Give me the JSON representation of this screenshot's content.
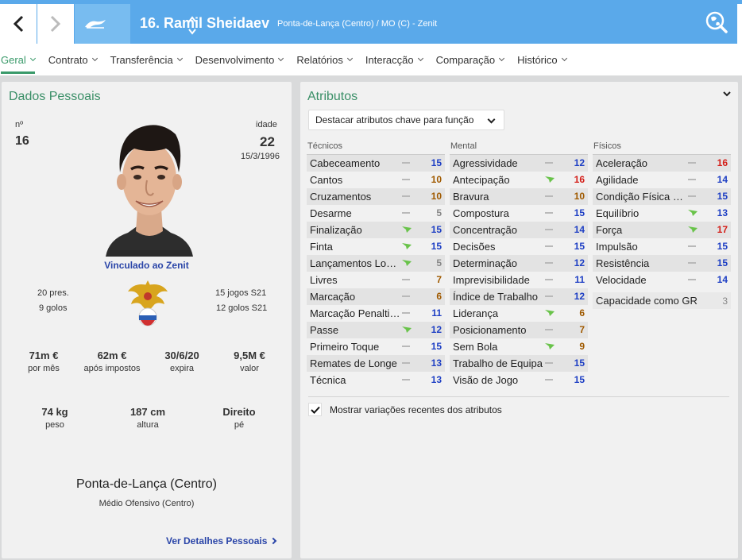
{
  "header": {
    "title": "16. Ramil Sheidaev",
    "subtitle": "Ponta-de-Lança (Centro) / MO (C) - Zenit"
  },
  "tabs": [
    {
      "label": "Geral",
      "active": true
    },
    {
      "label": "Contrato"
    },
    {
      "label": "Transferência"
    },
    {
      "label": "Desenvolvimento"
    },
    {
      "label": "Relatórios"
    },
    {
      "label": "Interacção"
    },
    {
      "label": "Comparação"
    },
    {
      "label": "Histórico"
    }
  ],
  "personal": {
    "heading": "Dados Pessoais",
    "number_label": "nº",
    "number": "16",
    "age_label": "idade",
    "age": "22",
    "dob": "15/3/1996",
    "linked": "Vinculado ao Zenit",
    "caps": "20 pres.",
    "goals": "9 golos",
    "u21_caps": "15 jogos S21",
    "u21_goals": "12 golos S21",
    "stats1": [
      {
        "value": "71m €",
        "label": "por mês"
      },
      {
        "value": "62m €",
        "label": "após impostos"
      },
      {
        "value": "30/6/20",
        "label": "expira"
      },
      {
        "value": "9,5M €",
        "label": "valor"
      }
    ],
    "stats2": [
      {
        "value": "74 kg",
        "label": "peso"
      },
      {
        "value": "187 cm",
        "label": "altura"
      },
      {
        "value": "Direito",
        "label": "pé"
      }
    ],
    "position": "Ponta-de-Lança (Centro)",
    "role": "Médio Ofensivo (Centro)",
    "details_link": "Ver Detalhes Pessoais"
  },
  "attributes": {
    "heading": "Atributos",
    "dropdown": "Destacar atributos chave para função",
    "colors": {
      "blue": "#1e3fc4",
      "orange": "#a05a00",
      "red": "#d4201a",
      "grey": "#888888"
    },
    "columns": [
      {
        "header": "Técnicos",
        "rows": [
          {
            "name": "Cabeceamento",
            "trend": "flat",
            "value": "15",
            "color": "blue"
          },
          {
            "name": "Cantos",
            "trend": "flat",
            "value": "10",
            "color": "orange"
          },
          {
            "name": "Cruzamentos",
            "trend": "flat",
            "value": "10",
            "color": "orange"
          },
          {
            "name": "Desarme",
            "trend": "flat",
            "value": "5",
            "color": "grey"
          },
          {
            "name": "Finalização",
            "trend": "up",
            "value": "15",
            "color": "blue"
          },
          {
            "name": "Finta",
            "trend": "up",
            "value": "15",
            "color": "blue"
          },
          {
            "name": "Lançamentos Lon...",
            "trend": "up",
            "value": "5",
            "color": "grey"
          },
          {
            "name": "Livres",
            "trend": "flat",
            "value": "7",
            "color": "orange"
          },
          {
            "name": "Marcação",
            "trend": "flat",
            "value": "6",
            "color": "orange"
          },
          {
            "name": "Marcação Penalties",
            "trend": "flat",
            "value": "11",
            "color": "blue"
          },
          {
            "name": "Passe",
            "trend": "up",
            "value": "12",
            "color": "blue"
          },
          {
            "name": "Primeiro Toque",
            "trend": "flat",
            "value": "15",
            "color": "blue"
          },
          {
            "name": "Remates de Longe",
            "trend": "flat",
            "value": "13",
            "color": "blue"
          },
          {
            "name": "Técnica",
            "trend": "flat",
            "value": "13",
            "color": "blue"
          }
        ]
      },
      {
        "header": "Mental",
        "rows": [
          {
            "name": "Agressividade",
            "trend": "flat",
            "value": "12",
            "color": "blue"
          },
          {
            "name": "Antecipação",
            "trend": "up",
            "value": "16",
            "color": "red"
          },
          {
            "name": "Bravura",
            "trend": "flat",
            "value": "10",
            "color": "orange"
          },
          {
            "name": "Compostura",
            "trend": "flat",
            "value": "15",
            "color": "blue"
          },
          {
            "name": "Concentração",
            "trend": "flat",
            "value": "14",
            "color": "blue"
          },
          {
            "name": "Decisões",
            "trend": "flat",
            "value": "15",
            "color": "blue"
          },
          {
            "name": "Determinação",
            "trend": "flat",
            "value": "12",
            "color": "blue"
          },
          {
            "name": "Imprevisibilidade",
            "trend": "flat",
            "value": "11",
            "color": "blue"
          },
          {
            "name": "Índice de Trabalho",
            "trend": "flat",
            "value": "12",
            "color": "blue"
          },
          {
            "name": "Liderança",
            "trend": "up",
            "value": "6",
            "color": "orange"
          },
          {
            "name": "Posicionamento",
            "trend": "flat",
            "value": "7",
            "color": "orange"
          },
          {
            "name": "Sem Bola",
            "trend": "up",
            "value": "9",
            "color": "orange"
          },
          {
            "name": "Trabalho de Equipa",
            "trend": "flat",
            "value": "15",
            "color": "blue"
          },
          {
            "name": "Visão de Jogo",
            "trend": "flat",
            "value": "15",
            "color": "blue"
          }
        ]
      },
      {
        "header": "Físicos",
        "rows": [
          {
            "name": "Aceleração",
            "trend": "flat",
            "value": "16",
            "color": "red"
          },
          {
            "name": "Agilidade",
            "trend": "flat",
            "value": "14",
            "color": "blue"
          },
          {
            "name": "Condição Física N...",
            "trend": "flat",
            "value": "15",
            "color": "blue"
          },
          {
            "name": "Equilíbrio",
            "trend": "up",
            "value": "13",
            "color": "blue"
          },
          {
            "name": "Força",
            "trend": "up",
            "value": "17",
            "color": "red"
          },
          {
            "name": "Impulsão",
            "trend": "flat",
            "value": "15",
            "color": "blue"
          },
          {
            "name": "Resistência",
            "trend": "flat",
            "value": "15",
            "color": "blue"
          },
          {
            "name": "Velocidade",
            "trend": "flat",
            "value": "14",
            "color": "blue"
          }
        ]
      }
    ],
    "gk_label": "Capacidade como GR",
    "gk_value": "3",
    "checkbox_label": "Mostrar variações recentes dos atributos",
    "checkbox_checked": true
  }
}
